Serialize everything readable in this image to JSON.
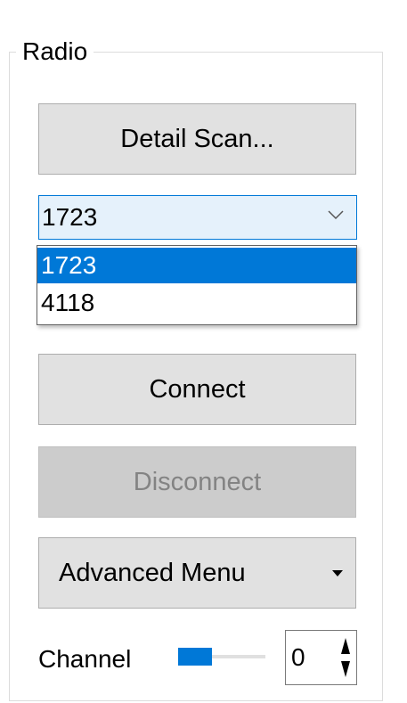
{
  "group": {
    "title": "Radio"
  },
  "buttons": {
    "detail_scan": "Detail Scan...",
    "connect": "Connect",
    "disconnect": "Disconnect",
    "advanced_menu": "Advanced Menu"
  },
  "combo": {
    "selected_value": "1723",
    "options": [
      "1723",
      "4118"
    ],
    "highlighted_index": 0
  },
  "channel": {
    "label": "Channel",
    "slider_level": 0.0,
    "spin_value": "0"
  },
  "colors": {
    "accent": "#0078d7",
    "button_face": "#e1e1e1",
    "disabled_face": "#cccccc",
    "disabled_text": "#838383"
  },
  "icons": {
    "combo_arrow": "chevron-down-icon",
    "advanced_menu_caret": "caret-down-icon",
    "spin_up": "triangle-up-icon",
    "spin_down": "triangle-down-icon"
  }
}
